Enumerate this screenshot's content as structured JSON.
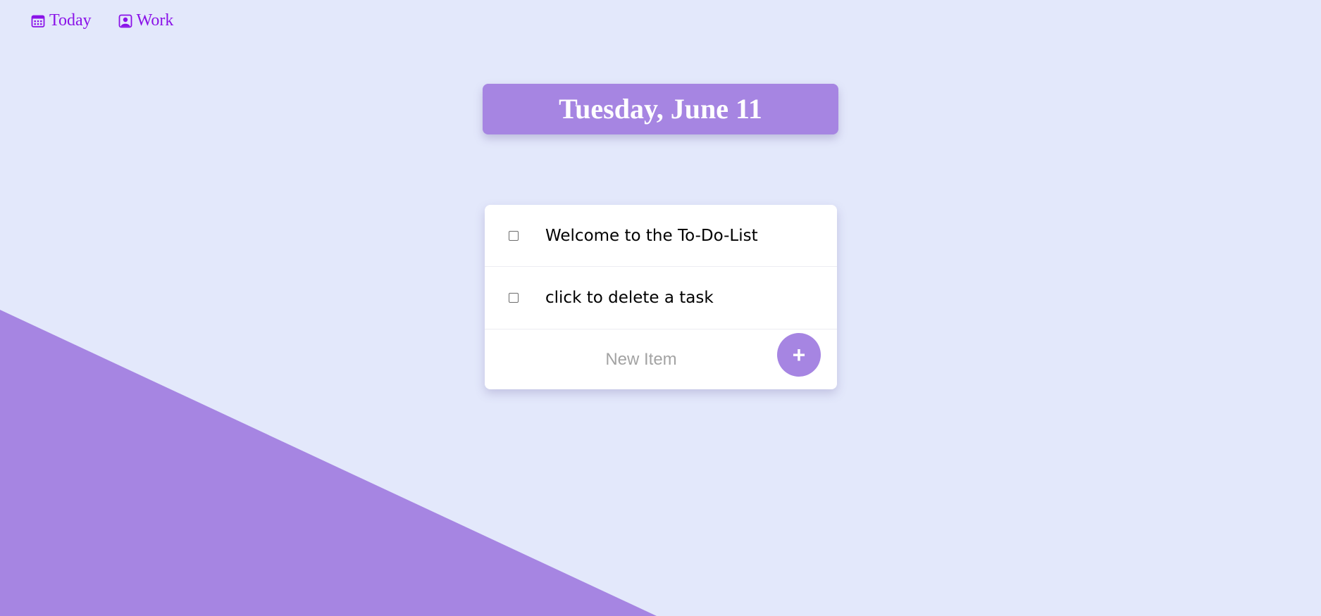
{
  "colors": {
    "background": "#e3e8fb",
    "accent": "#a685e2",
    "nav_link": "#8a12e8",
    "card": "#ffffff"
  },
  "nav": {
    "items": [
      {
        "label": "Today",
        "icon": "calendar-icon"
      },
      {
        "label": "Work",
        "icon": "briefcase-user-icon"
      }
    ]
  },
  "header": {
    "date": "Tuesday, June 11"
  },
  "todo": {
    "items": [
      {
        "text": "Welcome to the To-Do-List",
        "checked": false
      },
      {
        "text": "click to delete a task",
        "checked": false
      }
    ],
    "new_item_placeholder": "New Item",
    "add_button_label": "+"
  }
}
